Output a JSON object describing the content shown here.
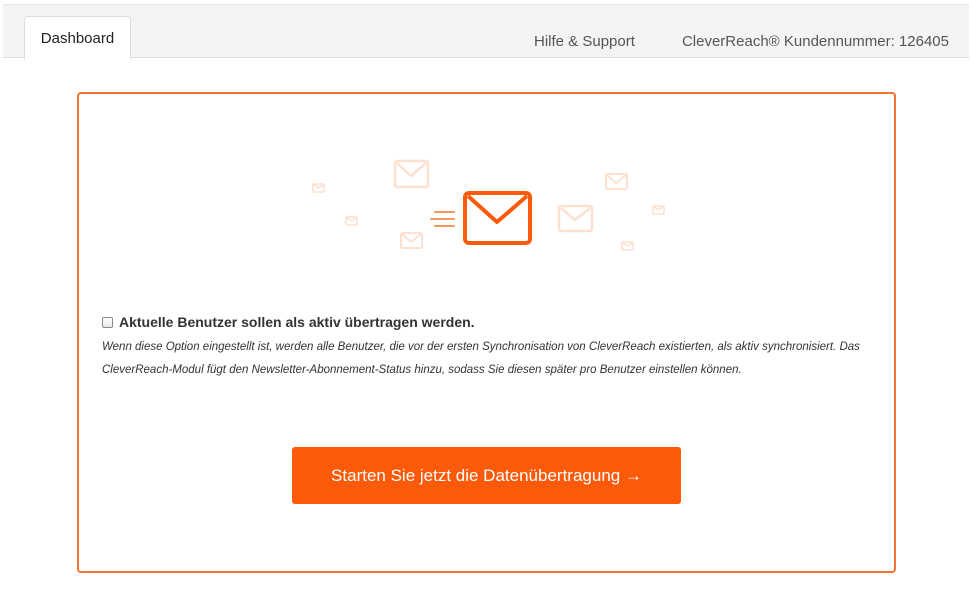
{
  "nav": {
    "tabs": [
      {
        "label": "Dashboard",
        "active": true
      }
    ],
    "help_link": "Hilfe & Support",
    "customer_number": "CleverReach® Kundennummer: 126405"
  },
  "sync_option": {
    "checked": false,
    "label": "Aktuelle Benutzer sollen als aktiv übertragen werden.",
    "description": "Wenn diese Option eingestellt ist, werden alle Benutzer, die vor der ersten Synchronisation von CleverReach existierten, als aktiv synchronisiert. Das CleverReach-Modul fügt den Newsletter-Abonnement-Status hinzu, sodass Sie diesen später pro Benutzer einstellen können."
  },
  "start_button": {
    "label": "Starten Sie jetzt die Datenübertragung →"
  },
  "colors": {
    "accent": "#fa5a0a",
    "border": "#f0742f",
    "icon_faded": "#fde0cf"
  },
  "icons": {
    "main": "envelope-icon",
    "decorative": "envelope-icon"
  }
}
